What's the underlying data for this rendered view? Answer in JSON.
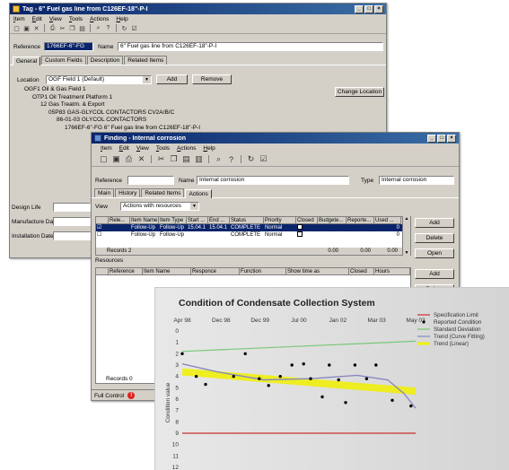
{
  "tag_window": {
    "title": "Tag - 6\" Fuel gas line from C126EF-18\"-P-I",
    "menu": [
      "Item",
      "Edit",
      "View",
      "Tools",
      "Actions",
      "Help"
    ],
    "reference_label": "Reference",
    "reference_value": "1766EF-6\"-FG",
    "name_label": "Name",
    "name_value": "6\" Fuel gas line from C126EF-18\"-P-I",
    "tabs": [
      "General",
      "Custom Fields",
      "Description",
      "Related Items"
    ],
    "location_label": "Location",
    "location_value": "OGF Field 1 (Default)",
    "add_label": "Add",
    "remove_label": "Remove",
    "change_location_label": "Change Location",
    "tree": [
      "OGF1  Oil & Gas Field 1",
      "OTP1  Oil Treatment Platform 1",
      "12  Gas Treatm. & Export",
      "05P83  GAS-GLYCOL CONTACTORS CV2A/B/C",
      "86-01-03  GLYCOL CONTACTORS",
      "1766EF-6\"-FG   6\" Fuel gas line from C126EF-18\"-P-I"
    ],
    "design_life_label": "Design Life",
    "manufacture_date_label": "Manufacture Date",
    "installation_date_label": "Installation Date"
  },
  "finding_window": {
    "title": "Finding - Internal corrosion",
    "menu": [
      "Item",
      "Edit",
      "View",
      "Tools",
      "Actions",
      "Help"
    ],
    "reference_label": "Reference",
    "name_label": "Name",
    "name_value": "Internal corrosion",
    "type_label": "Type",
    "type_value": "Internal corrosion",
    "tabs": [
      "Main",
      "History",
      "Related Items",
      "Actions"
    ],
    "view_label": "View",
    "view_value": "Actions with resources",
    "actions_headers": [
      "Rele...",
      "Item Name",
      "Item Type",
      "Start ...",
      "End ...",
      "Status",
      "Priority",
      "Closed",
      "Budgete...",
      "Reporte...",
      "Used ..."
    ],
    "actions_rows": [
      [
        "",
        "Follow-Up",
        "Follow-Up",
        "15.04.1",
        "15.04.1",
        "COMPLETE",
        "Normal",
        "",
        "",
        "",
        "0"
      ],
      [
        "",
        "Follow-Up",
        "Follow-Up",
        "",
        "",
        "COMPLETE",
        "Normal",
        "",
        "",
        "",
        "0"
      ]
    ],
    "records_label": "Records 2",
    "totals": [
      "0.00",
      "0.00",
      "0.00"
    ],
    "add_label": "Add",
    "delete_label": "Delete",
    "open_label": "Open",
    "resources_label": "Resources",
    "resources_headers": [
      "Reference",
      "Item Name",
      "Responce",
      "Function",
      "Show time as",
      "Closed",
      "Hours"
    ],
    "resources_add_label": "Add",
    "resources_delete_label": "Delete",
    "records0_label": "Records 0",
    "status_label": "Full Control"
  },
  "chart_data": {
    "type": "line",
    "title": "Condition of Condensate Collection System",
    "ylabel": "Condition value",
    "x_ticks": [
      "Apr 98",
      "Dec 98",
      "Dec 99",
      "Jul 00",
      "Jan 02",
      "Mar 03",
      "May 03"
    ],
    "ylim": [
      0,
      12
    ],
    "y_ticks": [
      "0",
      "1",
      "2",
      "3",
      "4",
      "5",
      "6",
      "7",
      "8",
      "9",
      "10",
      "11",
      "12"
    ],
    "legend": [
      "Specification Limit",
      "Reported Condition",
      "Standard Deviation",
      "Trend (Curve Fitting)",
      "Trend (Linear)"
    ],
    "colors": {
      "spec": "#c83232",
      "reported": "#000000",
      "stddev": "#78c878",
      "curve": "#8888c0",
      "linear": "#f0f000"
    },
    "specification_limit": 9,
    "standard_deviation": [
      [
        0,
        1.8
      ],
      [
        1,
        0.9
      ]
    ],
    "reported": [
      [
        0.0,
        2.0
      ],
      [
        0.06,
        4.0
      ],
      [
        0.1,
        4.7
      ],
      [
        0.22,
        4.0
      ],
      [
        0.27,
        2.0
      ],
      [
        0.33,
        4.2
      ],
      [
        0.37,
        4.8
      ],
      [
        0.42,
        4.0
      ],
      [
        0.47,
        3.0
      ],
      [
        0.52,
        2.9
      ],
      [
        0.55,
        4.2
      ],
      [
        0.6,
        5.8
      ],
      [
        0.63,
        3.0
      ],
      [
        0.67,
        4.3
      ],
      [
        0.7,
        6.3
      ],
      [
        0.74,
        3.0
      ],
      [
        0.79,
        4.2
      ],
      [
        0.83,
        3.0
      ],
      [
        0.9,
        6.1
      ],
      [
        0.98,
        6.6
      ]
    ],
    "curve_fit": [
      [
        0,
        2.9
      ],
      [
        0.15,
        3.6
      ],
      [
        0.35,
        4.3
      ],
      [
        0.55,
        4.2
      ],
      [
        0.75,
        3.9
      ],
      [
        0.88,
        4.3
      ],
      [
        0.95,
        5.5
      ],
      [
        1.0,
        6.8
      ]
    ],
    "linear_fit": [
      [
        0,
        3.6
      ],
      [
        1,
        5.3
      ]
    ]
  }
}
